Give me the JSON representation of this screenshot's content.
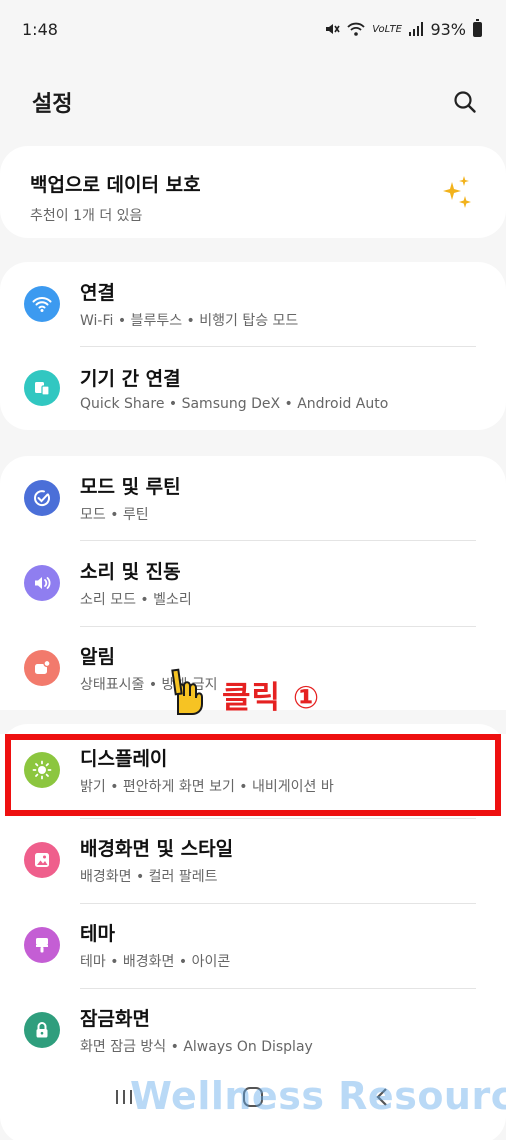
{
  "status_bar": {
    "time": "1:48",
    "network": "VoLTE",
    "battery": "93%"
  },
  "header": {
    "title": "설정"
  },
  "backup": {
    "title": "백업으로 데이터 보호",
    "subtitle": "추천이 1개 더 있음"
  },
  "group1": [
    {
      "title": "연결",
      "subtitle": "Wi-Fi • 블루투스 • 비행기 탑승 모드",
      "icon": "wifi-icon",
      "color": "#3c9af0"
    },
    {
      "title": "기기 간 연결",
      "subtitle": "Quick Share • Samsung DeX • Android Auto",
      "icon": "devices-icon",
      "color": "#31c7c1"
    }
  ],
  "group2": [
    {
      "title": "모드 및 루틴",
      "subtitle": "모드 • 루틴",
      "icon": "check-circle-icon",
      "color": "#4b6fd8"
    },
    {
      "title": "소리 및 진동",
      "subtitle": "소리 모드 • 벨소리",
      "icon": "speaker-icon",
      "color": "#8f7ef0"
    },
    {
      "title": "알림",
      "subtitle": "상태표시줄 • 방해 금지",
      "icon": "notification-icon",
      "color": "#f27a6c"
    },
    {
      "title": "디스플레이",
      "subtitle": "밝기 • 편안하게 화면 보기 • 내비게이션 바",
      "icon": "sun-icon",
      "color": "#8cc63f"
    },
    {
      "title": "배경화면 및 스타일",
      "subtitle": "배경화면 • 컬러 팔레트",
      "icon": "image-icon",
      "color": "#ef5f8c"
    },
    {
      "title": "테마",
      "subtitle": "테마 • 배경화면 • 아이콘",
      "icon": "brush-icon",
      "color": "#c45ed4"
    },
    {
      "title": "잠금화면",
      "subtitle": "화면 잠금 방식 • Always On Display",
      "icon": "lock-icon",
      "color": "#2f9e7d"
    }
  ],
  "annotation": {
    "label": "클릭 ①",
    "highlight_color": "#ee1010",
    "label_color": "#e52121"
  },
  "watermark": "Wellness Resources"
}
